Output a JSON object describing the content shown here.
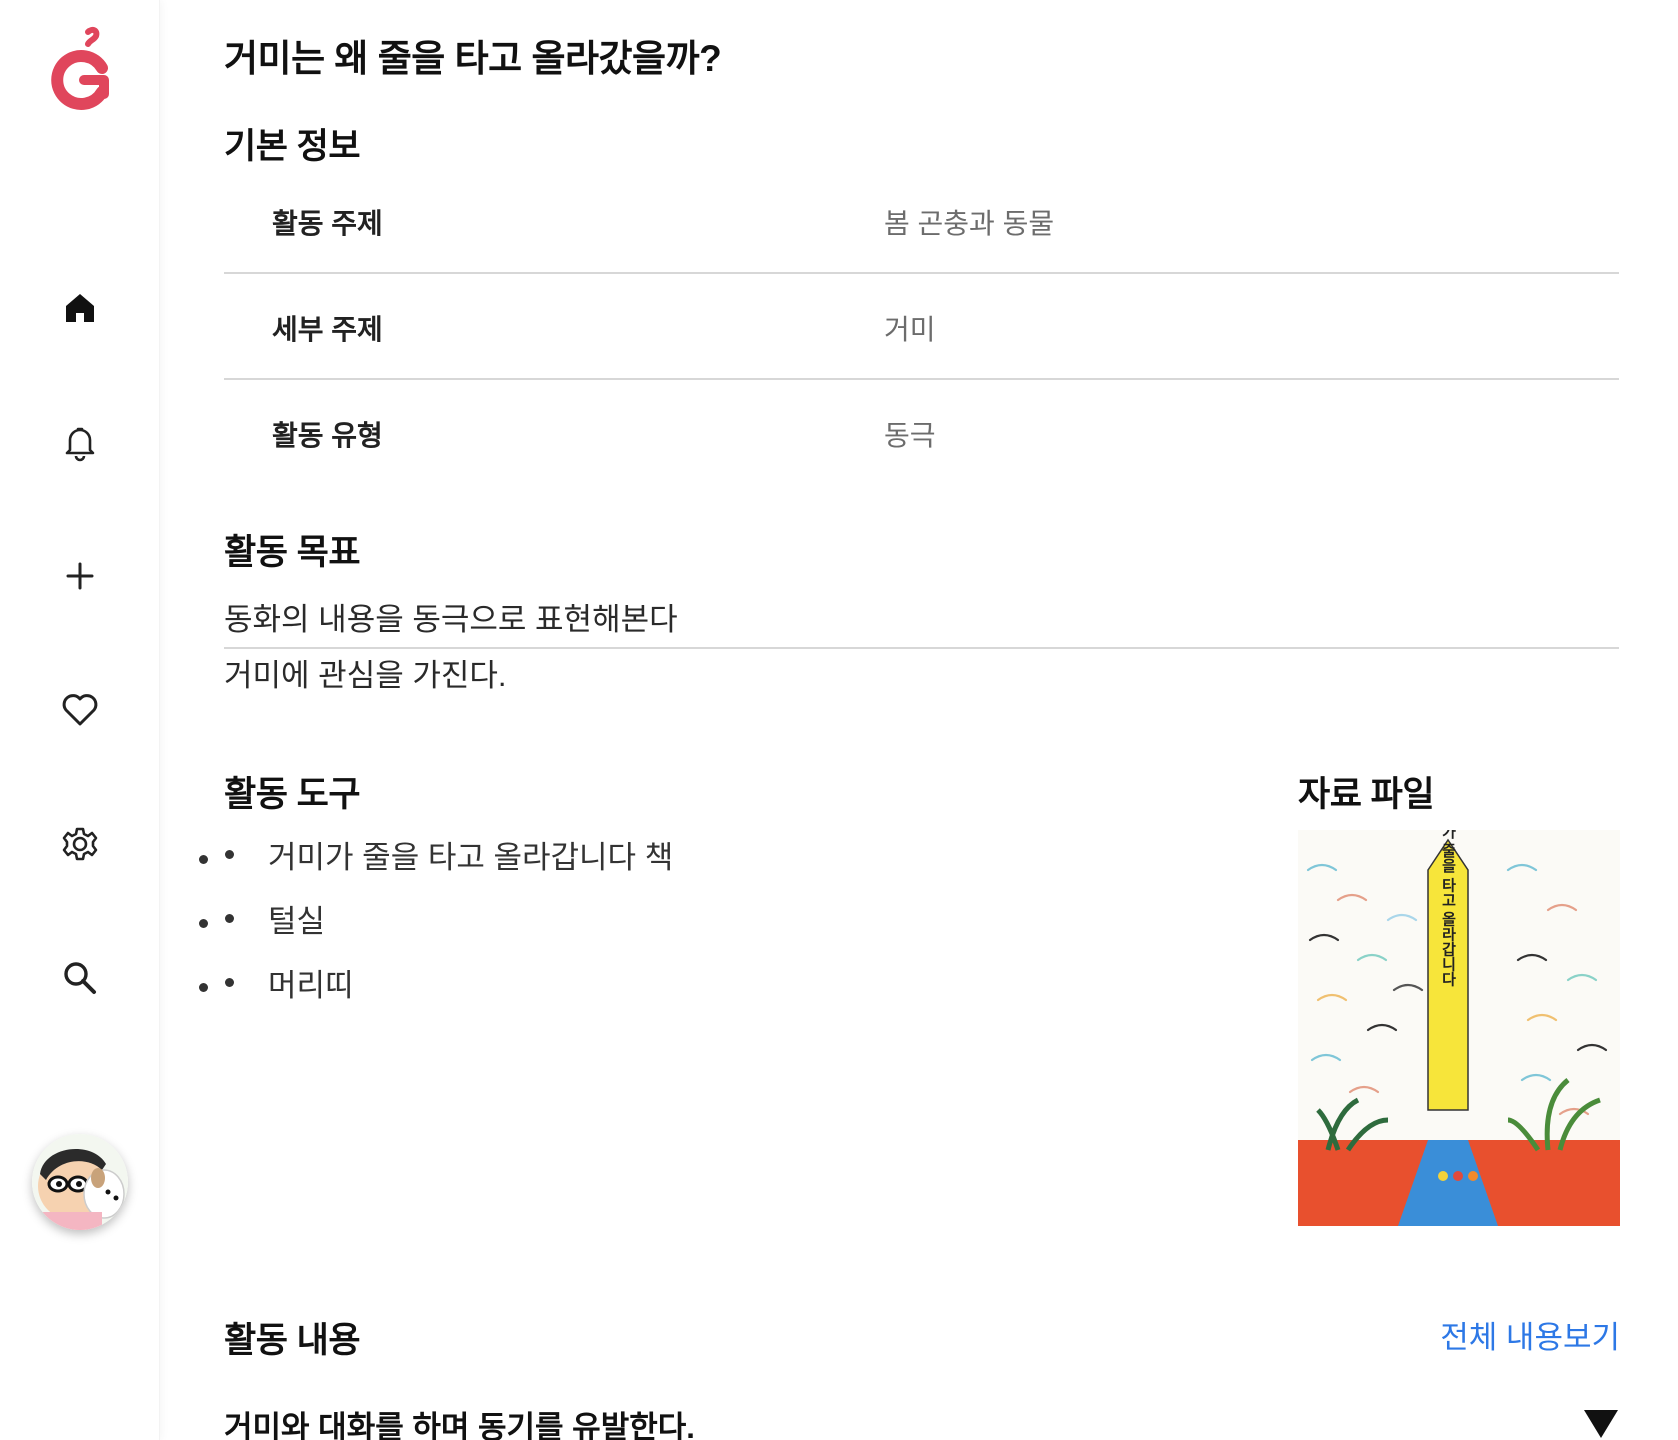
{
  "page": {
    "title": "거미는 왜 줄을 타고 올라갔을까?"
  },
  "sidebar": {
    "logo_icon": "g-logo-icon",
    "brand_color": "#e0465c",
    "items": [
      {
        "name": "home",
        "icon": "home-icon"
      },
      {
        "name": "notifications",
        "icon": "bell-icon"
      },
      {
        "name": "create",
        "icon": "plus-icon"
      },
      {
        "name": "favorites",
        "icon": "heart-icon"
      },
      {
        "name": "settings",
        "icon": "gear-icon"
      },
      {
        "name": "search",
        "icon": "search-icon"
      }
    ],
    "avatar_icon": "user-avatar"
  },
  "basic_info": {
    "title": "기본 정보",
    "rows": [
      {
        "label": "활동 주제",
        "value": "봄 곤충과 동물"
      },
      {
        "label": "세부 주제",
        "value": "거미"
      },
      {
        "label": "활동 유형",
        "value": "동극"
      }
    ]
  },
  "goals": {
    "title": "활동 목표",
    "items": [
      "동화의 내용을 동극으로 표현해본다",
      "거미에 관심을 가진다."
    ]
  },
  "tools": {
    "title": "활동 도구",
    "items": [
      "거미가 줄을 타고 올라갑니다 책",
      "털실",
      "머리띠"
    ]
  },
  "files": {
    "title": "자료 파일",
    "thumbnail_text": "거미가 줄을 타고 올라갑니다"
  },
  "activity_content": {
    "title": "활동 내용",
    "more_label": "전체 내용보기",
    "first_item": "거미와 대화를 하며 동기를 유발한다.",
    "toggle_icon": "triangle-down-icon",
    "link_color": "#2d78e6"
  }
}
